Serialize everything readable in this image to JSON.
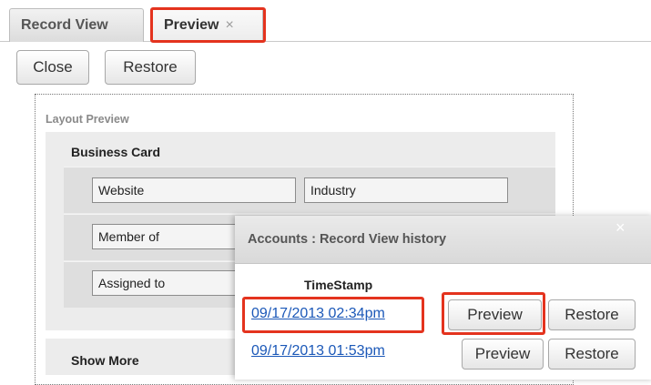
{
  "tabs": {
    "record_view": "Record View",
    "preview": "Preview",
    "close_glyph": "×"
  },
  "toolbar": {
    "close_label": "Close",
    "restore_label": "Restore"
  },
  "layout_preview": {
    "label": "Layout Preview",
    "panel_title": "Business Card",
    "fields": {
      "website": "Website",
      "industry": "Industry",
      "member_of": "Member of",
      "assigned_to": "Assigned to"
    },
    "show_more": "Show More"
  },
  "history_popup": {
    "title": "Accounts : Record View history",
    "close_glyph": "×",
    "column_header": "TimeStamp",
    "rows": [
      {
        "timestamp": "09/17/2013 02:34pm",
        "preview_label": "Preview",
        "restore_label": "Restore"
      },
      {
        "timestamp": "09/17/2013 01:53pm",
        "preview_label": "Preview",
        "restore_label": "Restore"
      }
    ]
  },
  "colors": {
    "highlight": "#e4331e",
    "link": "#1b58b8"
  }
}
